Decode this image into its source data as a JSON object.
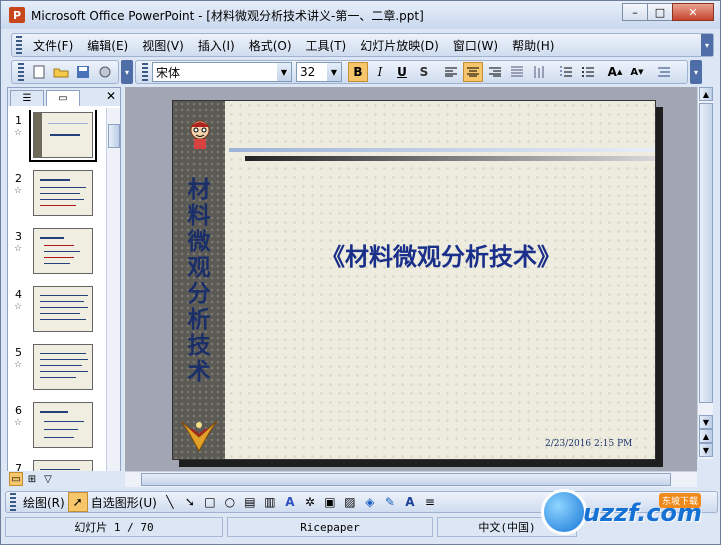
{
  "window": {
    "title": "Microsoft Office PowerPoint - [材料微观分析技术讲义-第一、二章.ppt]",
    "app_icon": "powerpoint-icon"
  },
  "menu": {
    "items": [
      "文件(F)",
      "编辑(E)",
      "视图(V)",
      "插入(I)",
      "格式(O)",
      "工具(T)",
      "幻灯片放映(D)",
      "窗口(W)",
      "帮助(H)"
    ]
  },
  "toolbar": {
    "font_name": "宋体",
    "font_size": "32",
    "bold": "B",
    "italic": "I",
    "underline": "U",
    "shadow": "S"
  },
  "slide": {
    "vertical_title": "材料微观分析技术",
    "main_title": "《材料微观分析技术》",
    "date": "2/23/2016 2:15 PM"
  },
  "thumbnails": {
    "numbers": [
      "1",
      "2",
      "3",
      "4",
      "5",
      "6",
      "7"
    ]
  },
  "drawbar": {
    "draw_label": "绘图(R)",
    "autoshape_label": "自选图形(U)"
  },
  "status": {
    "slide_pos": "幻灯片 1 / 70",
    "design": "Ricepaper",
    "language": "中文(中国)"
  },
  "watermark": {
    "text": "uzzf.com",
    "badge": "东坡下载"
  }
}
